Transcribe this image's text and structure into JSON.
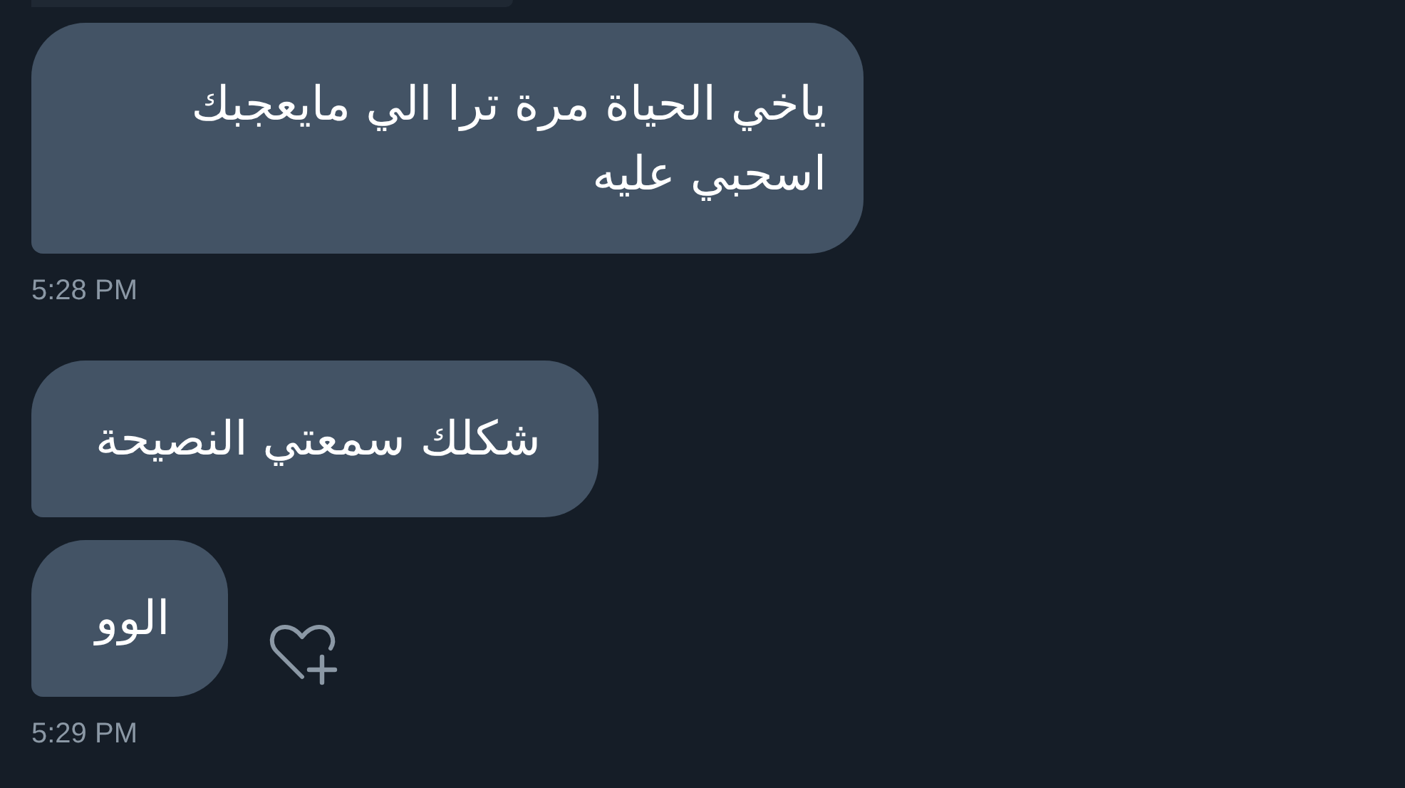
{
  "messages": [
    {
      "kind": "bubble_cut"
    },
    {
      "kind": "bubble",
      "text": "ياخي الحياة مرة ترا الي مايعجبك اسحبي عليه",
      "react_button": false
    },
    {
      "kind": "time",
      "text": "5:28 PM"
    },
    {
      "kind": "bubble",
      "text": "شكلك سمعتي النصيحة",
      "react_button": false
    },
    {
      "kind": "bubble",
      "text": "الوو",
      "react_button": true
    },
    {
      "kind": "time",
      "text": "5:29 PM"
    }
  ]
}
